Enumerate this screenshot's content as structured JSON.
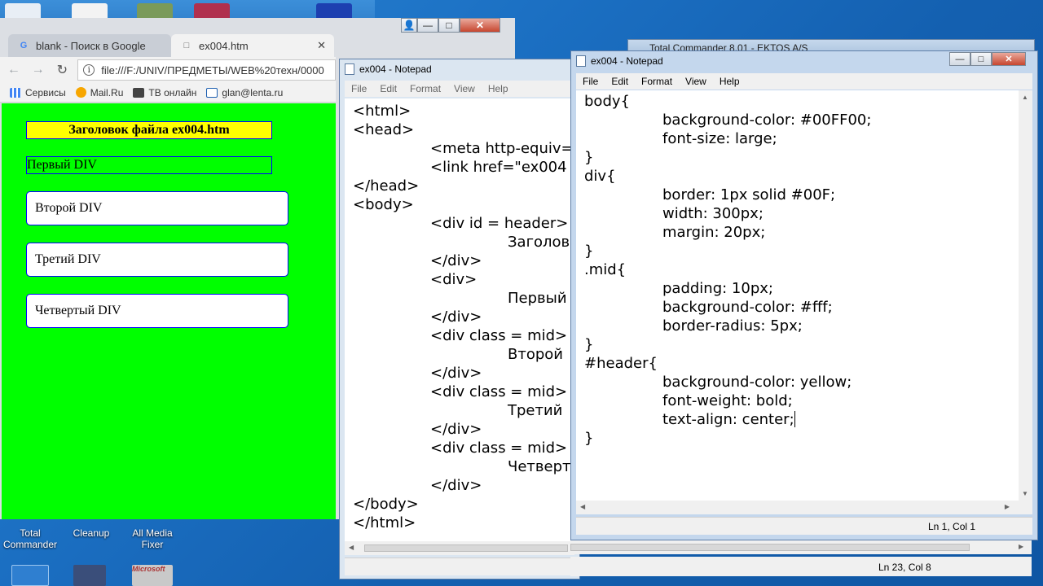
{
  "desktop": {
    "icons": [
      {
        "label": "Total\nCommander"
      },
      {
        "label": "Cleanup"
      },
      {
        "label": "All Media\nFixer"
      }
    ],
    "bottom_icon_label": "Microsoft"
  },
  "chrome": {
    "tabs": [
      {
        "label": "blank - Поиск в Google",
        "favicon": "G"
      },
      {
        "label": "ex004.htm",
        "favicon": "□"
      }
    ],
    "address": "file:///F:/UNIV/ПРЕДМЕТЫ/WEB%20техн/0000",
    "bookmarks": [
      {
        "label": "Сервисы",
        "icon": "apps-grid-icon"
      },
      {
        "label": "Mail.Ru",
        "icon": "mailru-icon"
      },
      {
        "label": "ТВ онлайн",
        "icon": "tv-icon"
      },
      {
        "label": "glan@lenta.ru",
        "icon": "mail-icon"
      }
    ],
    "page": {
      "header": "Заголовок файла ex004.htm",
      "div1": "Первый DIV",
      "div2": "Второй DIV",
      "div3": "Третий DIV",
      "div4": "Четвертый DIV"
    }
  },
  "total_commander": {
    "title": "Total Commander 8.01 - EKTOS A/S"
  },
  "notepad_html": {
    "title": "ex004 - Notepad",
    "menu": [
      "File",
      "Edit",
      "Format",
      "View",
      "Help"
    ],
    "lines": [
      "<html>",
      "<head>",
      "\t<meta http-equiv=",
      "\t<link href=\"ex004",
      "</head>",
      "<body>",
      "\t<div id = header>",
      "\t\tЗаголов",
      "\t</div>",
      "\t<div>",
      "\t\tПервый",
      "\t</div>",
      "\t<div class = mid>",
      "\t\tВторой",
      "\t</div>",
      "\t<div class = mid>",
      "\t\tТретий",
      "\t</div>",
      "\t<div class = mid>",
      "\t\tЧетверт",
      "\t</div>",
      "</body>",
      "</html>"
    ],
    "status": "Ln 23, Col 8"
  },
  "notepad_css": {
    "title": "ex004 - Notepad",
    "menu": [
      "File",
      "Edit",
      "Format",
      "View",
      "Help"
    ],
    "lines": [
      "body{",
      "\tbackground-color: #00FF00;",
      "\tfont-size: large;",
      "}",
      "div{",
      "\tborder: 1px solid #00F;",
      "\twidth: 300px;",
      "\tmargin: 20px;",
      "}",
      ".mid{",
      "\tpadding: 10px;",
      "\tbackground-color: #fff;",
      "\tborder-radius: 5px;",
      "}",
      "#header{",
      "\tbackground-color: yellow;",
      "\tfont-weight: bold;",
      "\ttext-align: center;",
      "}"
    ],
    "status": "Ln 1, Col 1"
  },
  "window_buttons": {
    "minimize": "—",
    "maximize": "□",
    "close": "✕"
  }
}
